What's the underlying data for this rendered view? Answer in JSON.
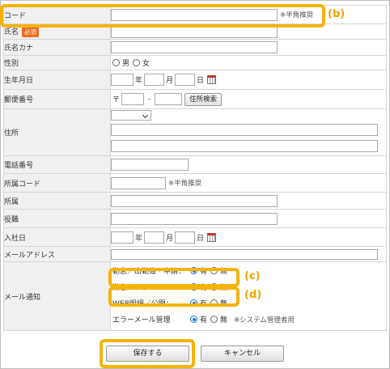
{
  "fields": {
    "code": {
      "label": "コード",
      "note": "※半角推奨"
    },
    "name": {
      "label": "氏名",
      "required_badge": "必須"
    },
    "name_kana": {
      "label": "氏名カナ"
    },
    "gender": {
      "label": "性別",
      "opt_male": "男",
      "opt_female": "女"
    },
    "birthdate": {
      "label": "生年月日",
      "year": "年",
      "month": "月",
      "day": "日"
    },
    "postal": {
      "label": "郵便番号",
      "mark": "〒",
      "dash": "-",
      "search_btn": "住所検索"
    },
    "address": {
      "label": "住所"
    },
    "phone": {
      "label": "電話番号"
    },
    "dept_code": {
      "label": "所属コード",
      "note": "※半角推奨"
    },
    "dept": {
      "label": "所属"
    },
    "position": {
      "label": "役職"
    },
    "join_date": {
      "label": "入社日",
      "year": "年",
      "month": "月",
      "day": "日"
    },
    "email": {
      "label": "メールアドレス"
    },
    "mail_notice": {
      "label": "メール通知",
      "rows": [
        {
          "label": "勤怠／出勤簿・申請：",
          "yes": "有",
          "no": "無",
          "selected": "yes"
        },
        {
          "label": "勤怠／アラート：",
          "yes": "有",
          "no": "無",
          "selected": "yes"
        },
        {
          "label": "WEB明細／公開：",
          "yes": "有",
          "no": "無",
          "selected": "yes"
        },
        {
          "label": "エラーメール管理",
          "yes": "有",
          "no": "無",
          "selected": "yes",
          "note": "※システム管理者用"
        }
      ]
    }
  },
  "annotations": {
    "b": "(b)",
    "c": "(c)",
    "d": "(d)"
  },
  "actions": {
    "save": "保存する",
    "cancel": "キャンセル"
  },
  "colors": {
    "highlight": "#f5b30a",
    "label_bg": "#f0f0f0",
    "required": "#f06a1e",
    "radio_on": "#1e6fd9"
  }
}
